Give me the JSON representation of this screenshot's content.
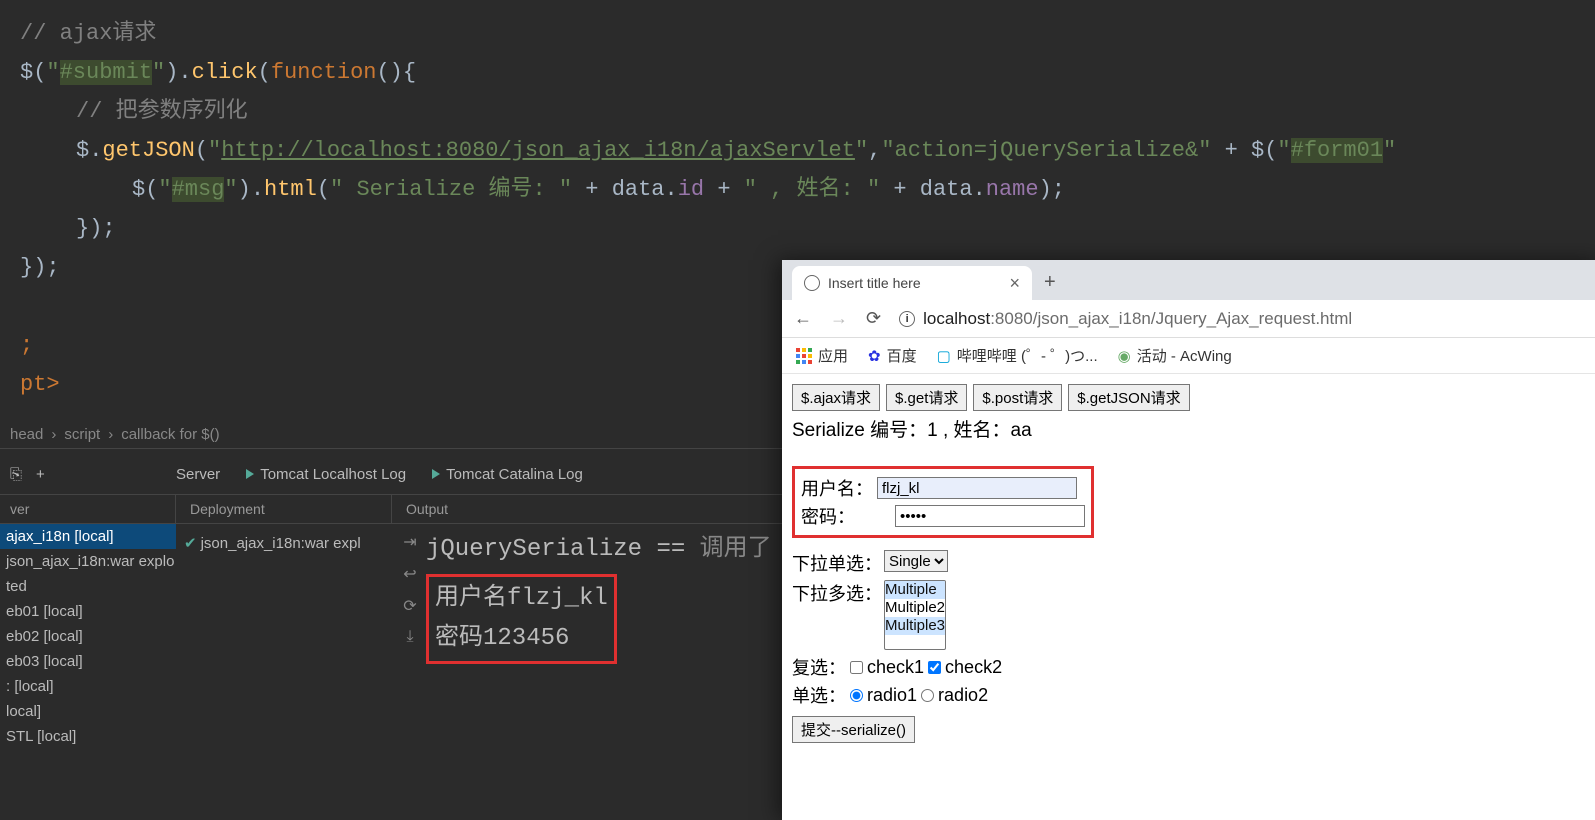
{
  "code": {
    "l1": "// ajax请求",
    "l2a": "$(",
    "l2b": "\"",
    "l2c": "#submit",
    "l2d": "\"",
    "l2e": ").",
    "l2f": "click",
    "l2g": "(",
    "l2h": "function",
    "l2i": "(){",
    "l3": "// 把参数序列化",
    "l4a": "$.",
    "l4b": "getJSON",
    "l4c": "(",
    "l4d": "\"",
    "l4e": "http://localhost:8080/json_ajax_i18n/ajaxServlet",
    "l4f": "\"",
    "l4g": ",",
    "l4h": "\"action=jQuerySerialize&\"",
    "l4i": " + $(",
    "l4j": "\"",
    "l4k": "#form01",
    "l4l": "\"",
    "l5a": "$(",
    "l5b": "\"",
    "l5c": "#msg",
    "l5d": "\"",
    "l5e": ").",
    "l5f": "html",
    "l5g": "(",
    "l5h": "\" Serialize 编号: \"",
    "l5i": " + data.",
    "l5j": "id",
    "l5k": " + ",
    "l5l": "\" , 姓名: \"",
    "l5m": " + data.",
    "l5n": "name",
    "l5o": ");",
    "l6": "});",
    "l7": "});",
    "l8": ";",
    "l9": "pt>"
  },
  "breadcrumb": {
    "a": "head",
    "b": "script",
    "c": "callback for $()"
  },
  "panel": {
    "server": "Server",
    "tomcat_local": "Tomcat Localhost Log",
    "tomcat_cat": "Tomcat Catalina Log",
    "ver": "ver",
    "deployment": "Deployment",
    "output": "Output",
    "deploy_item": "json_ajax_i18n:war expl"
  },
  "sidebar": {
    "items": [
      "ajax_i18n [local]",
      " json_ajax_i18n:war explo",
      "ted",
      "eb01 [local]",
      "eb02 [local]",
      "eb03 [local]",
      ": [local]",
      "local]",
      "STL [local]"
    ]
  },
  "console": {
    "l1a": "jQuerySerialize == ",
    "l1b": "调用了",
    "l2": "用户名flzj_kl",
    "l3": "密码123456"
  },
  "browser": {
    "tab_title": "Insert title here",
    "url_host": "localhost",
    "url_port_path": ":8080/json_ajax_i18n/Jquery_Ajax_request.html",
    "bk_apps": "应用",
    "bk_baidu": "百度",
    "bk_bili": "哔哩哔哩 (゜- ゜)つ...",
    "bk_acwing": "活动 - AcWing"
  },
  "page": {
    "btn1": "$.ajax请求",
    "btn2": "$.get请求",
    "btn3": "$.post请求",
    "btn4": "$.getJSON请求",
    "result": "Serialize 编号：1 , 姓名：aa",
    "lbl_user": "用户名：",
    "val_user": "flzj_kl",
    "lbl_pass": "密码：",
    "val_pass": "•••••",
    "lbl_single": "下拉单选：",
    "opt_single": "Single",
    "lbl_multi": "下拉多选：",
    "opt_m1": "Multiple",
    "opt_m2": "Multiple2",
    "opt_m3": "Multiple3",
    "lbl_check": "复选：",
    "chk1": "check1",
    "chk2": "check2",
    "lbl_radio": "单选：",
    "rad1": "radio1",
    "rad2": "radio2",
    "submit": "提交--serialize()"
  }
}
